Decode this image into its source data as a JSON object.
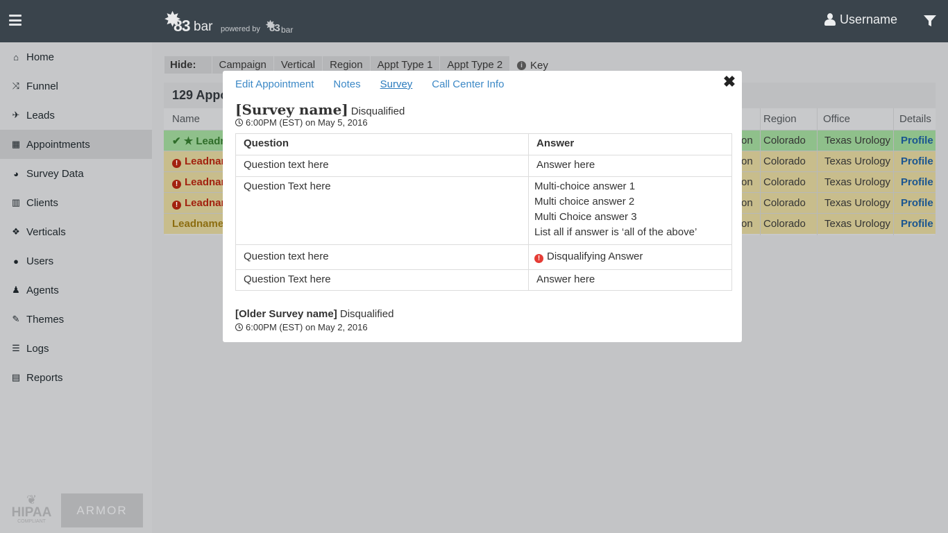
{
  "header": {
    "logo_text": "83bar",
    "logo_num": "83",
    "logo_suffix": "bar",
    "powered_by": "powered by",
    "username": "Username"
  },
  "sidebar": {
    "items": [
      {
        "label": "Home",
        "icon": "home-icon"
      },
      {
        "label": "Funnel",
        "icon": "random-icon"
      },
      {
        "label": "Leads",
        "icon": "plane-icon"
      },
      {
        "label": "Appointments",
        "icon": "calendar-check-icon",
        "active": true
      },
      {
        "label": "Survey Data",
        "icon": "pie-chart-icon"
      },
      {
        "label": "Clients",
        "icon": "building-icon"
      },
      {
        "label": "Verticals",
        "icon": "cubes-icon"
      },
      {
        "label": "Users",
        "icon": "users-icon"
      },
      {
        "label": "Agents",
        "icon": "user-secret-icon"
      },
      {
        "label": "Themes",
        "icon": "paint-brush-icon"
      },
      {
        "label": "Logs",
        "icon": "list-alt-icon"
      },
      {
        "label": "Reports",
        "icon": "file-text-icon"
      }
    ],
    "hipaa": {
      "main": "HIPAA",
      "sub": "COMPLIANT"
    },
    "armor": "ARMOR"
  },
  "hide_bar": {
    "label": "Hide:",
    "options": [
      "Campaign",
      "Vertical",
      "Region",
      "Appt Type 1",
      "Appt Type 2"
    ],
    "key_label": "Key"
  },
  "panel": {
    "title": "129 Appo",
    "col_name": "Name",
    "col_region": "Region",
    "col_office": "Office",
    "col_details": "Details",
    "rows": [
      {
        "name": "Leadn",
        "partial": "on",
        "region": "Colorado",
        "office": "Texas Urology",
        "details": "Profile"
      },
      {
        "name": "Leadnan",
        "partial": "on",
        "region": "Colorado",
        "office": "Texas Urology",
        "details": "Profile"
      },
      {
        "name": "Leadnan",
        "partial": "on",
        "region": "Colorado",
        "office": "Texas Urology",
        "details": "Profile"
      },
      {
        "name": "Leadnan",
        "partial": "on",
        "region": "Colorado",
        "office": "Texas Urology",
        "details": "Profile"
      },
      {
        "name": "Leadname",
        "partial": "on",
        "region": "Colorado",
        "office": "Texas Urology",
        "details": "Profile"
      }
    ]
  },
  "modal": {
    "tabs": [
      "Edit Appointment",
      "Notes",
      "Survey",
      "Call Center Info"
    ],
    "active_tab": "Survey",
    "survey": {
      "name": "[Survey name]",
      "status": "Disqualified",
      "time": "6:00PM (EST) on May 5, 2016",
      "col_question": "Question",
      "col_answer": "Answer",
      "rows": [
        {
          "q": "Question text here",
          "a": [
            "Answer here"
          ]
        },
        {
          "q": "Question Text here",
          "a": [
            "Multi-choice answer 1",
            "Multi choice answer 2",
            "Multi Choice answer 3",
            "List all if answer is ‘all of the above’"
          ]
        },
        {
          "q": "Question text here",
          "a": [
            "Disqualifying Answer"
          ],
          "disqualifying": true
        },
        {
          "q": "Question Text here",
          "a": [
            "Answer here"
          ]
        }
      ]
    },
    "older": {
      "name": "[Older Survey name]",
      "status": "Disqualified",
      "time": "6:00PM (EST) on May 2, 2016"
    }
  },
  "colors": {
    "topbar": "#3a444c",
    "link": "#3b88c6",
    "disqualify_red": "#e53c35",
    "row_green": "#8fc08b",
    "row_yellow": "#c8bd8c"
  }
}
